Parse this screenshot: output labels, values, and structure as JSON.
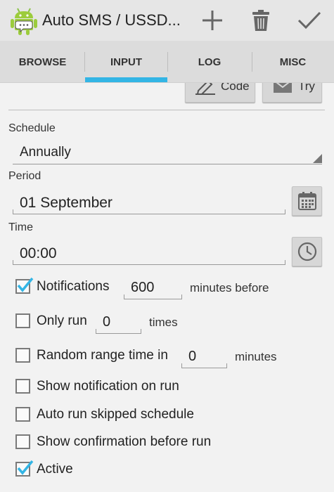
{
  "app": {
    "title": "Auto SMS / USSD...",
    "icon": "android-chat-icon"
  },
  "actionbar": {
    "actions": [
      {
        "name": "add-icon"
      },
      {
        "name": "delete-icon"
      },
      {
        "name": "confirm-icon"
      }
    ]
  },
  "tabs": [
    {
      "label": "BROWSE",
      "selected": false
    },
    {
      "label": "INPUT",
      "selected": true
    },
    {
      "label": "LOG",
      "selected": false
    },
    {
      "label": "MISC",
      "selected": false
    }
  ],
  "accent": "#33b5e5",
  "top_buttons": {
    "code_label": "Code",
    "try_label": "Try"
  },
  "schedule": {
    "label": "Schedule",
    "value": "Annually"
  },
  "period": {
    "label": "Period",
    "value": "01 September",
    "button_icon": "calendar-icon"
  },
  "time": {
    "label": "Time",
    "value": "00:00",
    "button_icon": "clock-icon"
  },
  "options": {
    "notifications": {
      "label": "Notifications",
      "checked": true,
      "value": "600",
      "suffix": "minutes before"
    },
    "only_run": {
      "label": "Only run",
      "checked": false,
      "value": "0",
      "suffix": "times"
    },
    "random_range": {
      "label": "Random range time in",
      "checked": false,
      "value": "0",
      "suffix": "minutes"
    },
    "show_notification": {
      "label": "Show notification on run",
      "checked": false
    },
    "auto_run_skipped": {
      "label": "Auto run skipped schedule",
      "checked": false
    },
    "show_confirmation": {
      "label": "Show confirmation before run",
      "checked": false
    },
    "active": {
      "label": "Active",
      "checked": true
    }
  }
}
